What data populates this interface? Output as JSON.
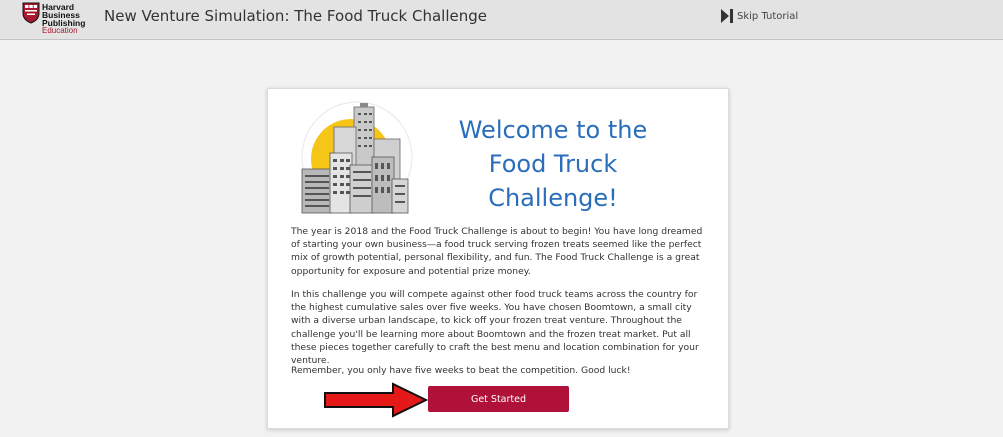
{
  "header": {
    "logo_lines": [
      "Harvard",
      "Business",
      "Publishing",
      "Education"
    ],
    "title": "New Venture Simulation: The Food Truck Challenge",
    "skip_label": "Skip Tutorial"
  },
  "card": {
    "illustration_name": "city-skyline-sun",
    "welcome_title": "Welcome to the\nFood Truck\nChallenge!",
    "paragraphs": [
      "The year is 2018 and the Food Truck Challenge is about to begin! You have long dreamed of starting your own business—a food truck serving frozen treats seemed like the perfect mix of growth potential, personal flexibility, and fun. The Food Truck Challenge is a great opportunity for exposure and potential prize money.",
      "In this challenge you will compete against other food truck teams across the country for the highest cumulative sales over five weeks. You have chosen Boomtown, a small city with a diverse urban landscape, to kick off your frozen treat venture. Throughout the challenge you'll be learning more about Boomtown and the frozen treat market. Put all these pieces together carefully to craft the best menu and location combination for your venture.",
      "Remember, you only have five weeks to beat the competition. Good luck!"
    ],
    "cta_label": "Get Started"
  },
  "colors": {
    "accent": "#b01138",
    "title_blue": "#2a6ebb",
    "arrow_red": "#e61919",
    "sun_yellow": "#f5c518"
  }
}
